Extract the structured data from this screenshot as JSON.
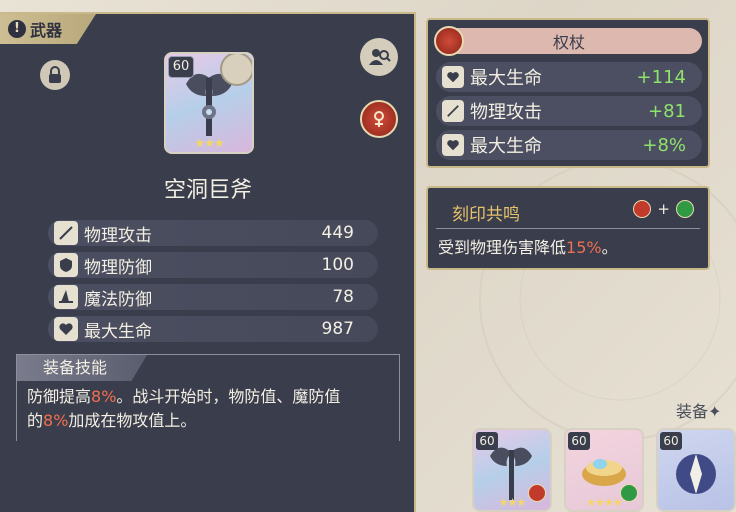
{
  "category": {
    "label": "武器",
    "icon": "exclamation-icon"
  },
  "item": {
    "name": "空洞巨斧",
    "level": "60",
    "stars": "★★★",
    "element_color": "#c23a2b"
  },
  "base_stats": [
    {
      "icon": "sword-icon",
      "label": "物理攻击",
      "value": "449"
    },
    {
      "icon": "shield-icon",
      "label": "物理防御",
      "value": "100"
    },
    {
      "icon": "wizard-hat-icon",
      "label": "魔法防御",
      "value": "78"
    },
    {
      "icon": "heart-icon",
      "label": "最大生命",
      "value": "987"
    }
  ],
  "skill": {
    "header": "装备技能",
    "line1_a": "防御提高",
    "line1_b": "8%",
    "line1_c": "。战斗开始时，物防值、魔防值",
    "line2_a": "的",
    "line2_b": "8%",
    "line2_c": "加成在物攻值上。"
  },
  "weapon_type": {
    "label": "权杖"
  },
  "bonus_stats": [
    {
      "icon": "heart-icon",
      "label": "最大生命",
      "value": "+114"
    },
    {
      "icon": "sword-icon",
      "label": "物理攻击",
      "value": "+81"
    },
    {
      "icon": "heart-icon",
      "label": "最大生命",
      "value": "+8%"
    }
  ],
  "resonance": {
    "title": "刻印共鸣",
    "plus": "+",
    "text_a": "受到物理伤害降低",
    "text_b": "15%",
    "text_c": "。"
  },
  "equipment": {
    "label": "装备✦",
    "slots": [
      {
        "level": "60",
        "stars": "★★★",
        "name": "axe"
      },
      {
        "level": "60",
        "stars": "★★★★",
        "name": "gem-bowl"
      },
      {
        "level": "60",
        "stars": "",
        "name": "crystal"
      }
    ]
  },
  "colors": {
    "panel": "#3a3d4c",
    "gold": "#c9b98a",
    "highlight": "#f06f4e",
    "bonus_green": "#8fe36d",
    "resonance_title": "#e6c36a"
  }
}
